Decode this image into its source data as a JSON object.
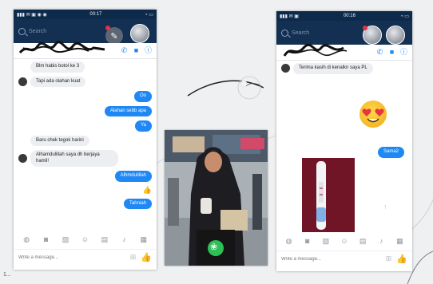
{
  "left_phone": {
    "status_time": "00:17",
    "search_placeholder": "Search",
    "messages": [
      {
        "dir": "in",
        "text": "Blm habis botol ke 3",
        "avatar": false
      },
      {
        "dir": "in",
        "text": "Tapi ada olahan kuat",
        "avatar": true
      },
      {
        "dir": "out",
        "text": "Oo"
      },
      {
        "dir": "out",
        "text": "Alahan sebb apa"
      },
      {
        "dir": "out",
        "text": "Ya"
      },
      {
        "dir": "in",
        "text": "Baru chek tegok harini",
        "avatar": false
      },
      {
        "dir": "in",
        "text": "Alhamdulillah saya dh berjaya hamil!",
        "avatar": true
      },
      {
        "dir": "out",
        "text": "Alhmdulillah"
      },
      {
        "dir": "out",
        "text": "Tahniah"
      }
    ],
    "composer_placeholder": "Write a message..."
  },
  "right_phone": {
    "status_time": "00:16",
    "search_placeholder": "Search",
    "messages": [
      {
        "dir": "in",
        "text": "Terima kasih di kenalkn saya PL",
        "avatar": true
      },
      {
        "dir": "out",
        "text": "Sama2"
      }
    ],
    "composer_placeholder": "Write a message..."
  },
  "photo": {
    "bag_logo": "❀"
  },
  "footer": {
    "corner_text": "1..."
  },
  "colors": {
    "messenger_blue": "#1e88f5",
    "header_navy": "#132f52"
  }
}
